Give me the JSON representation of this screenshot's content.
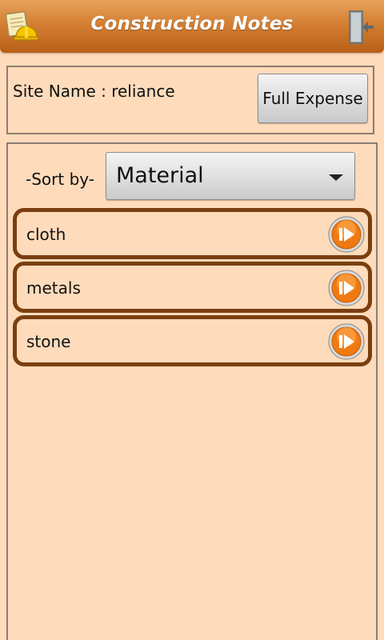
{
  "header": {
    "title": "Construction Notes",
    "logo_icon": "notes-hardhat-icon",
    "exit_icon": "exit-door-icon"
  },
  "site": {
    "label": "Site Name : reliance",
    "full_expense_label": "Full Expense"
  },
  "sort": {
    "label": "-Sort by-",
    "selected": "Material"
  },
  "items": [
    {
      "label": "cloth",
      "icon": "play-arrow-icon"
    },
    {
      "label": "metals",
      "icon": "play-arrow-icon"
    },
    {
      "label": "stone",
      "icon": "play-arrow-icon"
    }
  ],
  "colors": {
    "background": "#fedbbb",
    "header_top": "#e9a25c",
    "header_bottom": "#b85f17",
    "item_border": "#7a3f10",
    "go_button": "#f07a12"
  }
}
